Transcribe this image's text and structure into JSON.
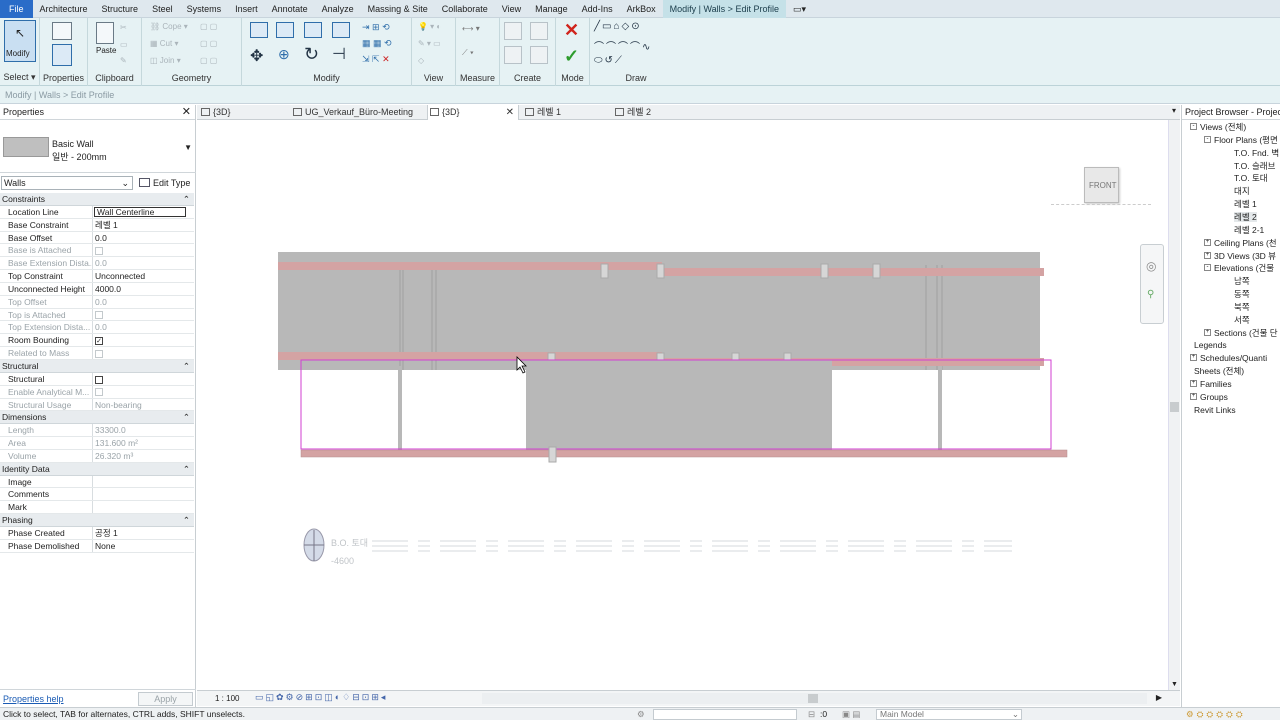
{
  "menubar": {
    "tabs": [
      "File",
      "Architecture",
      "Structure",
      "Steel",
      "Systems",
      "Insert",
      "Annotate",
      "Analyze",
      "Massing & Site",
      "Collaborate",
      "View",
      "Manage",
      "Add-Ins",
      "ArkBox",
      "Modify | Walls > Edit Profile"
    ]
  },
  "ribbon": {
    "select": {
      "modify": "Modify",
      "label": "Select"
    },
    "properties_label": "Properties",
    "clipboard": {
      "paste": "Paste",
      "cope": "Cope",
      "cut": "Cut",
      "join": "Join",
      "label": "Clipboard"
    },
    "geometry_label": "Geometry",
    "modify_label": "Modify",
    "view_label": "View",
    "measure_label": "Measure",
    "create_label": "Create",
    "mode_label": "Mode",
    "draw_label": "Draw"
  },
  "context_bar": "Modify | Walls > Edit Profile",
  "properties": {
    "title": "Properties",
    "type_name": "Basic Wall",
    "type_sub": "일반 - 200mm",
    "filter": "Walls",
    "edit_type": "Edit Type",
    "sections": [
      {
        "name": "Constraints",
        "rows": [
          {
            "k": "Location Line",
            "v": "Wall Centerline",
            "box": true
          },
          {
            "k": "Base Constraint",
            "v": "레벨 1"
          },
          {
            "k": "Base Offset",
            "v": "0.0"
          },
          {
            "k": "Base is Attached",
            "v": "",
            "cb": "dis",
            "dis": true
          },
          {
            "k": "Base Extension Dista...",
            "v": "0.0",
            "dis": true
          },
          {
            "k": "Top Constraint",
            "v": "Unconnected"
          },
          {
            "k": "Unconnected Height",
            "v": "4000.0"
          },
          {
            "k": "Top Offset",
            "v": "0.0",
            "dis": true
          },
          {
            "k": "Top is Attached",
            "v": "",
            "cb": "dis",
            "dis": true
          },
          {
            "k": "Top Extension Dista...",
            "v": "0.0",
            "dis": true
          },
          {
            "k": "Room Bounding",
            "v": "",
            "cb": "checked"
          },
          {
            "k": "Related to Mass",
            "v": "",
            "cb": "dis",
            "dis": true
          }
        ]
      },
      {
        "name": "Structural",
        "rows": [
          {
            "k": "Structural",
            "v": "",
            "cb": "empty"
          },
          {
            "k": "Enable Analytical M...",
            "v": "",
            "cb": "dis",
            "dis": true
          },
          {
            "k": "Structural Usage",
            "v": "Non-bearing",
            "dis": true
          }
        ]
      },
      {
        "name": "Dimensions",
        "rows": [
          {
            "k": "Length",
            "v": "33300.0",
            "dis": true
          },
          {
            "k": "Area",
            "v": "131.600 m²",
            "dis": true
          },
          {
            "k": "Volume",
            "v": "26.320 m³",
            "dis": true
          }
        ]
      },
      {
        "name": "Identity Data",
        "rows": [
          {
            "k": "Image",
            "v": ""
          },
          {
            "k": "Comments",
            "v": ""
          },
          {
            "k": "Mark",
            "v": ""
          }
        ]
      },
      {
        "name": "Phasing",
        "rows": [
          {
            "k": "Phase Created",
            "v": "공정 1"
          },
          {
            "k": "Phase Demolished",
            "v": "None"
          }
        ]
      }
    ],
    "help": "Properties help",
    "apply": "Apply"
  },
  "view_tabs": [
    {
      "label": "{3D}"
    },
    {
      "label": "UG_Verkauf_Büro-Meeting"
    },
    {
      "label": "{3D}",
      "active": true
    },
    {
      "label": "레벨 1"
    },
    {
      "label": "레벨 2"
    }
  ],
  "canvas": {
    "viewcube": "FRONT",
    "level_labels": [
      "B.O. 토대",
      "-4600"
    ]
  },
  "project_browser": {
    "title": "Project Browser - Project",
    "nodes": [
      {
        "label": "Views (전체)",
        "depth": 0,
        "exp": "-"
      },
      {
        "label": "Floor Plans (평면",
        "depth": 1,
        "exp": "-"
      },
      {
        "label": "T.O. Fnd. 벽",
        "depth": 2
      },
      {
        "label": "T.O. 슬래브",
        "depth": 2
      },
      {
        "label": "T.O. 토대",
        "depth": 2
      },
      {
        "label": "대지",
        "depth": 2
      },
      {
        "label": "레벨 1",
        "depth": 2
      },
      {
        "label": "레벨 2",
        "depth": 2,
        "sel": true
      },
      {
        "label": "레벨 2-1",
        "depth": 2
      },
      {
        "label": "Ceiling Plans (천",
        "depth": 1,
        "exp": "+"
      },
      {
        "label": "3D Views (3D 뷰",
        "depth": 1,
        "exp": "+"
      },
      {
        "label": "Elevations (건물",
        "depth": 1,
        "exp": "-"
      },
      {
        "label": "남쪽",
        "depth": 2
      },
      {
        "label": "동쪽",
        "depth": 2
      },
      {
        "label": "북쪽",
        "depth": 2
      },
      {
        "label": "서쪽",
        "depth": 2
      },
      {
        "label": "Sections (건물 단",
        "depth": 1,
        "exp": "+"
      },
      {
        "label": "Legends",
        "depth": 0
      },
      {
        "label": "Schedules/Quanti",
        "depth": 0,
        "exp": "+"
      },
      {
        "label": "Sheets (전체)",
        "depth": 0
      },
      {
        "label": "Families",
        "depth": 0,
        "exp": "+"
      },
      {
        "label": "Groups",
        "depth": 0,
        "exp": "+"
      },
      {
        "label": "Revit Links",
        "depth": 0
      }
    ]
  },
  "view_control": {
    "scale": "1 : 100"
  },
  "status": {
    "message": "Click to select, TAB for alternates, CTRL adds, SHIFT unselects.",
    "workset_count": ":0",
    "model": "Main Model"
  }
}
